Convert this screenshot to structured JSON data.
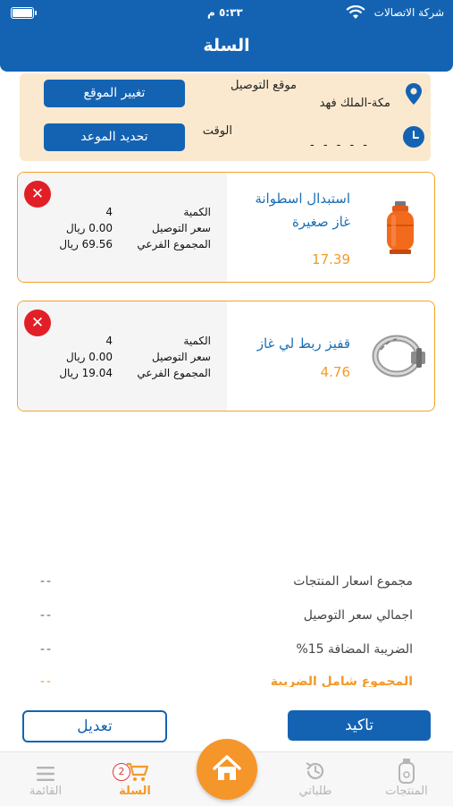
{
  "status_bar": {
    "carrier": "شركة الاتصالات",
    "time": "٥:٣٣ م"
  },
  "header": {
    "title": "السلة"
  },
  "delivery": {
    "location_label": "موقع التوصيل",
    "location_value": "مكة-الملك فهد",
    "change_location_button": "تغيير الموقع",
    "time_label": "الوقت",
    "time_value": "- - - - -",
    "set_time_button": "تحديد الموعد"
  },
  "cart_items": [
    {
      "name_line1": "استبدال اسطوانة",
      "name_line2": "غاز صغيرة",
      "price": "17.39",
      "quantity_label": "الكمية",
      "quantity": "4",
      "delivery_label": "سعر التوصيل",
      "delivery_price": "0.00 ريال",
      "subtotal_label": "المجموع الفرعي",
      "subtotal": "69.56 ريال",
      "image": "gas-cylinder"
    },
    {
      "name_line1": "قفيز ربط لي غاز",
      "name_line2": "",
      "price": "4.76",
      "quantity_label": "الكمية",
      "quantity": "4",
      "delivery_label": "سعر التوصيل",
      "delivery_price": "0.00 ريال",
      "subtotal_label": "المجموع الفرعي",
      "subtotal": "19.04 ريال",
      "image": "hose-clamp"
    }
  ],
  "totals": [
    {
      "label": "مجموع اسعار المنتجات",
      "value": "--"
    },
    {
      "label": "اجمالي سعر التوصيل",
      "value": "--"
    },
    {
      "label": "الضريبة المضافة 15%",
      "value": "--"
    },
    {
      "label": "المجموع شامل الضريبة",
      "value": "--"
    }
  ],
  "actions": {
    "confirm": "تاكيد",
    "edit": "تعديل"
  },
  "tabbar": {
    "products": "المنتجات",
    "orders": "طلباتي",
    "cart": "السلة",
    "cart_count": "2",
    "menu": "القائمة"
  },
  "colors": {
    "primary": "#1463b3",
    "accent": "#f39a2a",
    "delete": "#e21f26",
    "card_bg": "#fbe9cf"
  }
}
